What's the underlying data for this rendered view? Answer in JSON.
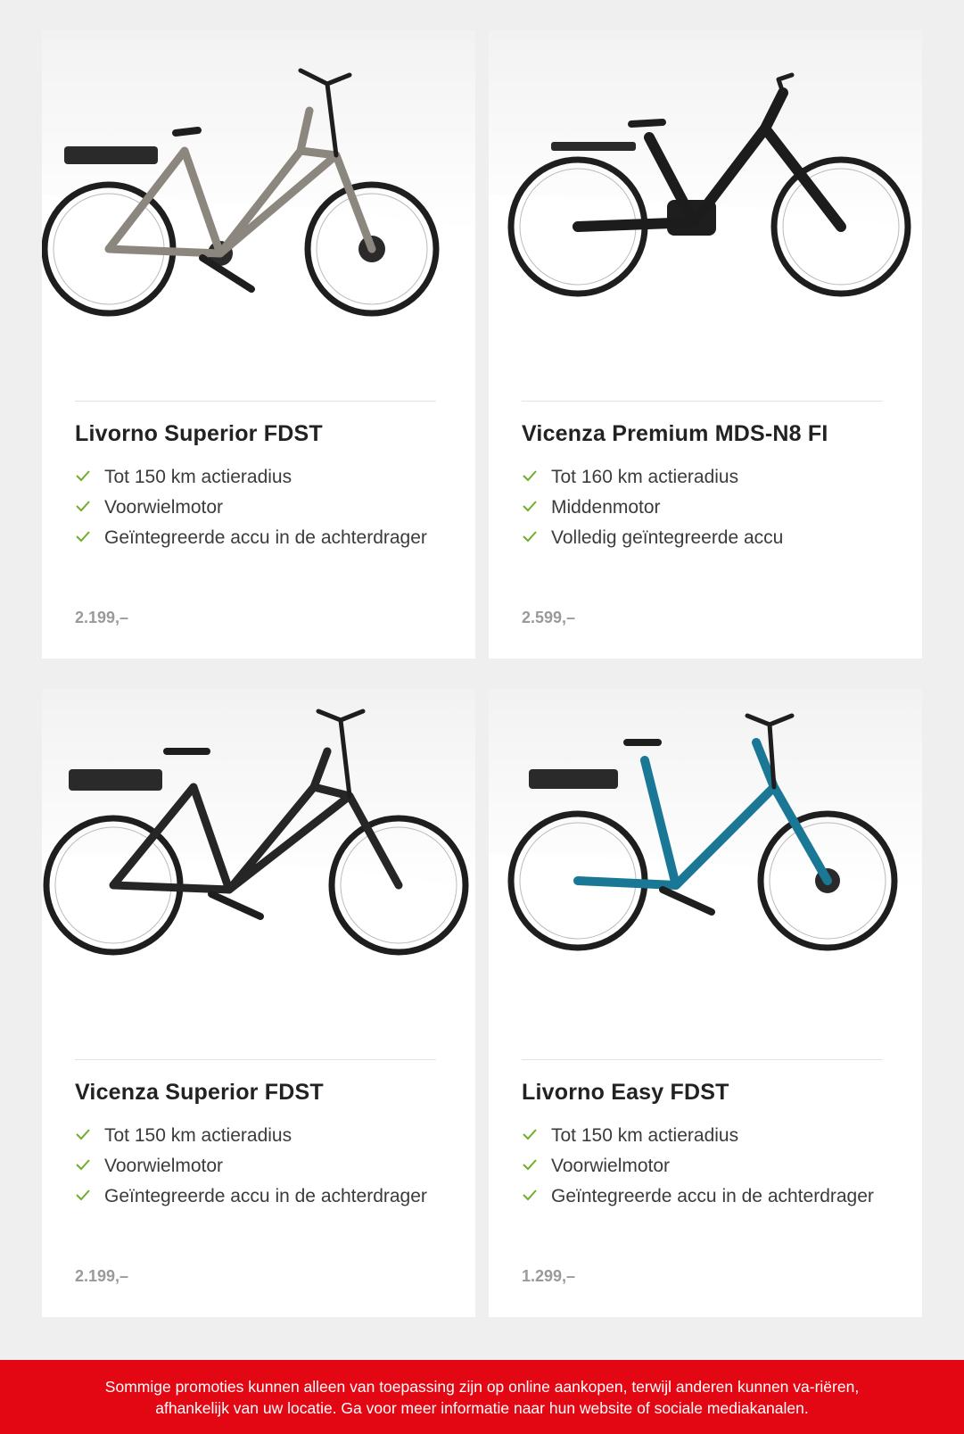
{
  "colors": {
    "check": "#6fae2c",
    "footer_bg": "#e30613",
    "price": "#9a9a9a"
  },
  "products": [
    {
      "name": "Livorno Superior FDST",
      "features": [
        "Tot 150 km actieradius",
        "Voorwielmotor",
        "Geïntegreerde accu in de achterdrager"
      ],
      "price": "2.199,–",
      "frame_color": "#8b877e",
      "image_icon": "bike-icon"
    },
    {
      "name": "Vicenza Premium MDS-N8 FI",
      "features": [
        "Tot 160 km actieradius",
        "Middenmotor",
        "Volledig geïntegreerde accu"
      ],
      "price": "2.599,–",
      "frame_color": "#1c1c1c",
      "image_icon": "bike-icon"
    },
    {
      "name": "Vicenza Superior FDST",
      "features": [
        "Tot 150 km actieradius",
        "Voorwielmotor",
        "Geïntegreerde accu in de achterdrager"
      ],
      "price": "2.199,–",
      "frame_color": "#262626",
      "image_icon": "bike-icon"
    },
    {
      "name": "Livorno Easy FDST",
      "features": [
        "Tot 150 km actieradius",
        "Voorwielmotor",
        "Geïntegreerde accu in de achterdrager"
      ],
      "price": "1.299,–",
      "frame_color": "#1a7896",
      "image_icon": "bike-icon"
    }
  ],
  "footer": {
    "text": "Sommige promoties kunnen alleen van toepassing zijn op online aankopen, terwijl anderen kunnen va-riëren, afhankelijk van uw locatie. Ga voor meer informatie naar hun website of sociale mediakanalen."
  }
}
